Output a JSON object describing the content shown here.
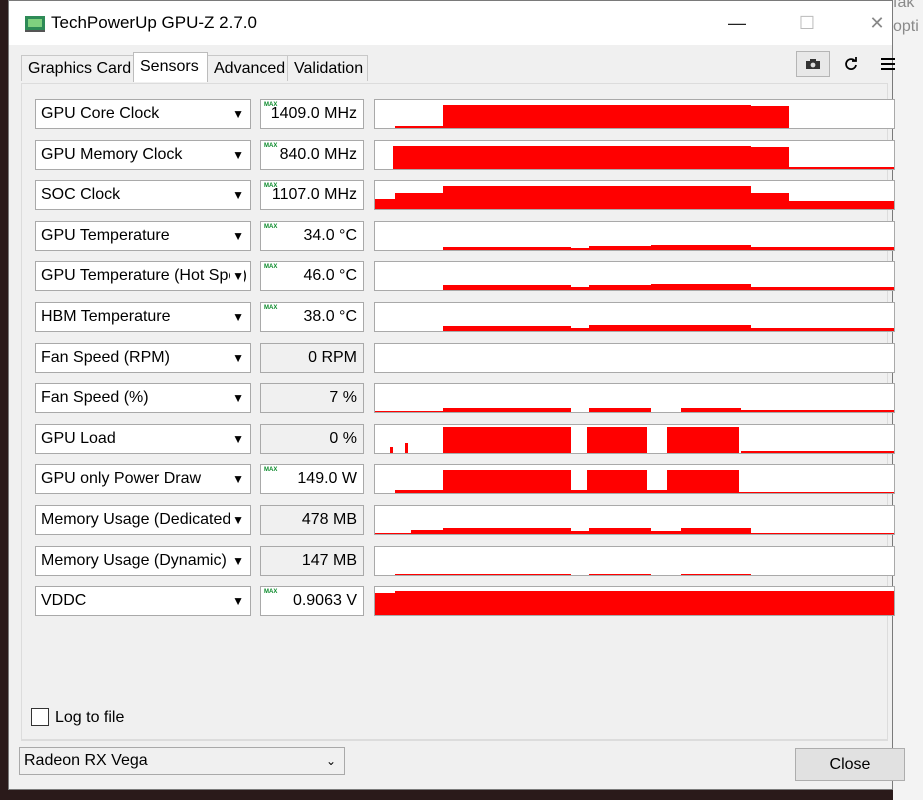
{
  "window": {
    "title": "TechPowerUp GPU-Z 2.7.0",
    "controls": {
      "minimize": "—",
      "maximize": "☐",
      "close": "✕"
    }
  },
  "background_text": [
    "fak",
    "opti"
  ],
  "tabs": [
    {
      "label": "Graphics Card",
      "active": false
    },
    {
      "label": "Sensors",
      "active": true
    },
    {
      "label": "Advanced",
      "active": false
    },
    {
      "label": "Validation",
      "active": false
    }
  ],
  "toolbar": {
    "screenshot_icon": "camera-icon",
    "refresh_icon": "refresh-icon",
    "menu_icon": "menu-icon"
  },
  "accent_color": "#ff0000",
  "max_indicator": "MAX",
  "sensors": [
    {
      "name": "GPU Core Clock",
      "value": "1409.0 MHz",
      "max": true
    },
    {
      "name": "GPU Memory Clock",
      "value": "840.0 MHz",
      "max": true
    },
    {
      "name": "SOC Clock",
      "value": "1107.0 MHz",
      "max": true
    },
    {
      "name": "GPU Temperature",
      "value": "34.0 °C",
      "max": true
    },
    {
      "name": "GPU Temperature (Hot Spot)",
      "value": "46.0 °C",
      "max": true
    },
    {
      "name": "HBM Temperature",
      "value": "38.0 °C",
      "max": true
    },
    {
      "name": "Fan Speed (RPM)",
      "value": "0 RPM",
      "max": false
    },
    {
      "name": "Fan Speed (%)",
      "value": "7 %",
      "max": false
    },
    {
      "name": "GPU Load",
      "value": "0 %",
      "max": false
    },
    {
      "name": "GPU only Power Draw",
      "value": "149.0 W",
      "max": true
    },
    {
      "name": "Memory Usage (Dedicated)",
      "value": "478 MB",
      "max": false
    },
    {
      "name": "Memory Usage (Dynamic)",
      "value": "147 MB",
      "max": false
    },
    {
      "name": "VDDC",
      "value": "0.9063 V",
      "max": true
    }
  ],
  "log_to_file": {
    "label": "Log to file",
    "checked": false
  },
  "gpu_select": {
    "value": "Radeon RX Vega"
  },
  "close_label": "Close"
}
